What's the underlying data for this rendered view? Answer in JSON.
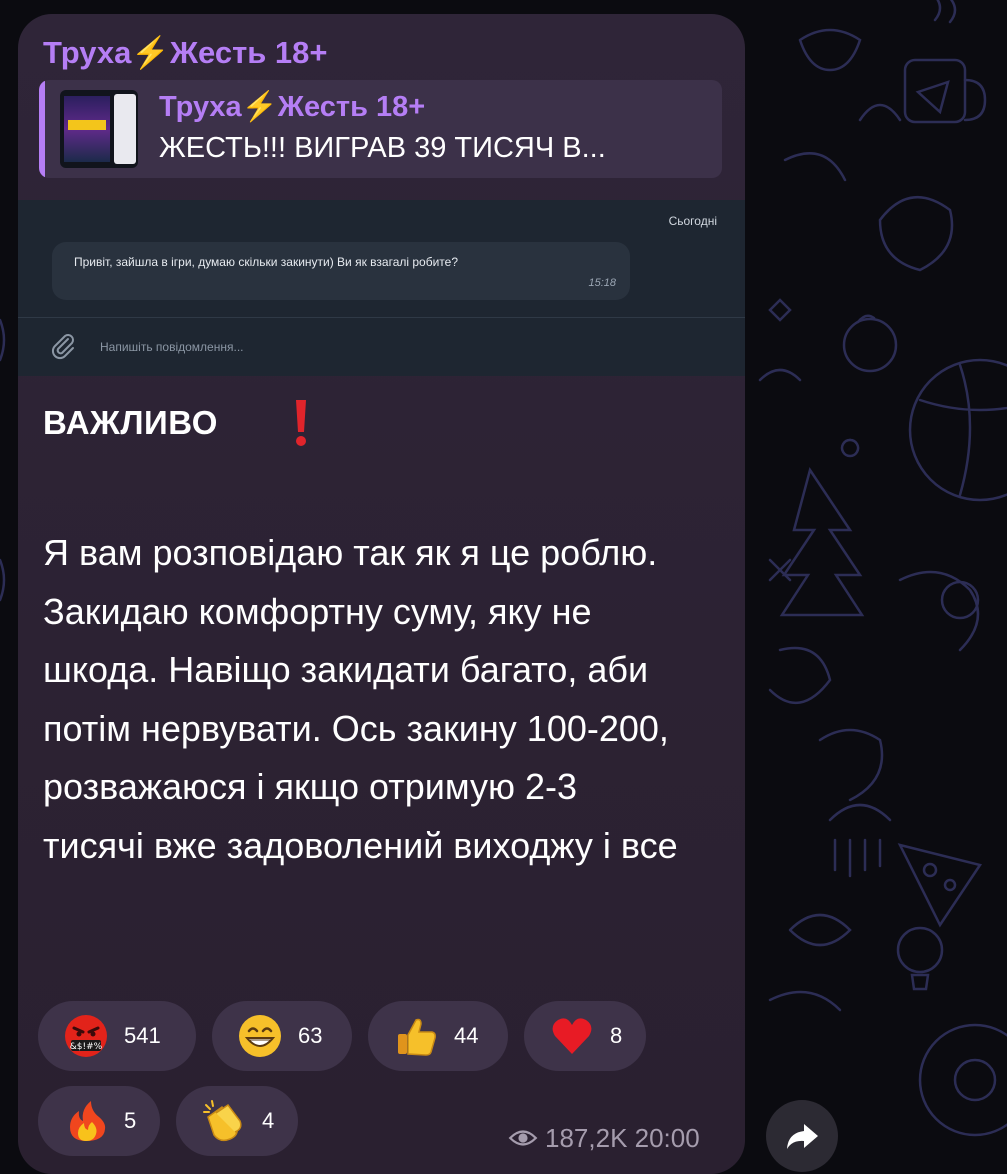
{
  "post": {
    "channel_name": "Труха⚡️Жесть 18+",
    "reply": {
      "title": "Труха⚡️Жесть 18+",
      "text": "ЖЕСТЬ!!! ВИГРАВ 39 ТИСЯЧ В..."
    },
    "screenshot": {
      "date": "Сьогодні",
      "message": "Привіт, зайшла в ігри, думаю скільки закинути) Ви як взагалі робите?",
      "time": "15:18",
      "input_placeholder": "Напишіть повідомлення..."
    },
    "heading": "ВАЖЛИВО",
    "body": "Я вам розповідаю так як я це роблю. Закидаю комфортну суму, яку не шкода. Навіщо закидати багато, аби потім нервувати. Ось закину 100-200, розважаюся і якщо отримую 2-3 тисячі вже задоволений виходжу і все",
    "reactions": [
      {
        "emoji": "cursing-face",
        "count": "541"
      },
      {
        "emoji": "grinning-face",
        "count": "63"
      },
      {
        "emoji": "thumbs-up",
        "count": "44"
      },
      {
        "emoji": "red-heart",
        "count": "8"
      },
      {
        "emoji": "fire",
        "count": "5"
      },
      {
        "emoji": "clapping-hands",
        "count": "4"
      }
    ],
    "views": "187,2K",
    "time": "20:00"
  },
  "colors": {
    "accent": "#b57ef5",
    "bubble": "#2c2233",
    "reaction_bg": "#3e3349",
    "meta_text": "#a59cad"
  }
}
